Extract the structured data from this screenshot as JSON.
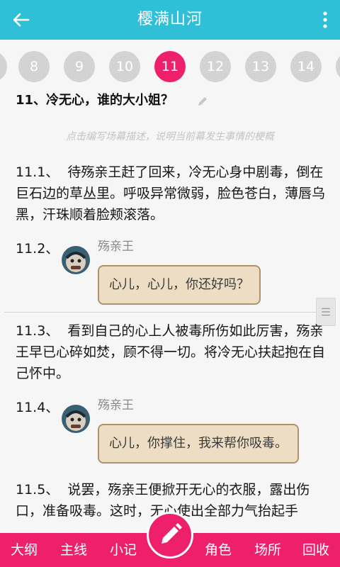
{
  "appbar": {
    "title": "樱满山河"
  },
  "chapters": [
    {
      "label": "8",
      "active": false
    },
    {
      "label": "9",
      "active": false
    },
    {
      "label": "10",
      "active": false
    },
    {
      "label": "11",
      "active": true
    },
    {
      "label": "12",
      "active": false
    },
    {
      "label": "13",
      "active": false
    },
    {
      "label": "14",
      "active": false
    }
  ],
  "scene": {
    "title": "11、冷无心，谁的大小姐？",
    "hint": "点击编写场幕描述，说明当前幕发生事情的梗概"
  },
  "entries": {
    "e1": {
      "number": "11.1、",
      "text": "待殇亲王赶了回来，冷无心身中剧毒，倒在巨石边的草丛里。呼吸异常微弱，脸色苍白，薄唇乌黑，汗珠顺着脸颊滚落。"
    },
    "e2": {
      "number": "11.2、",
      "speaker": "殇亲王",
      "text": "心儿，心儿，你还好吗？"
    },
    "e3": {
      "number": "11.3、",
      "text": "看到自己的心上人被毒所伤如此厉害，殇亲王早已心碎如焚，顾不得一切。将冷无心扶起抱在自己怀中。"
    },
    "e4": {
      "number": "11.4、",
      "speaker": "殇亲王",
      "text": "心儿，你撑住，我来帮你吸毒。"
    },
    "e5": {
      "number": "11.5、",
      "text": "说罢，殇亲王便掀开无心的衣服，露出伤口，准备吸毒。这时，无心使出全部力气抬起手"
    }
  },
  "bottom_nav": {
    "outline": "大纲",
    "mainline": "主线",
    "notes": "小记",
    "roles": "角色",
    "places": "场所",
    "recycle": "回收"
  },
  "colors": {
    "appbar": "#2fc0d8",
    "accent": "#ee1f6b",
    "bubble_fill": "#eeddc5",
    "bubble_border": "#b1926a"
  },
  "icons": {
    "back": "arrow-left-icon",
    "more": "more-vert-icon",
    "edit": "pencil-icon",
    "drag": "drag-handle-icon"
  }
}
